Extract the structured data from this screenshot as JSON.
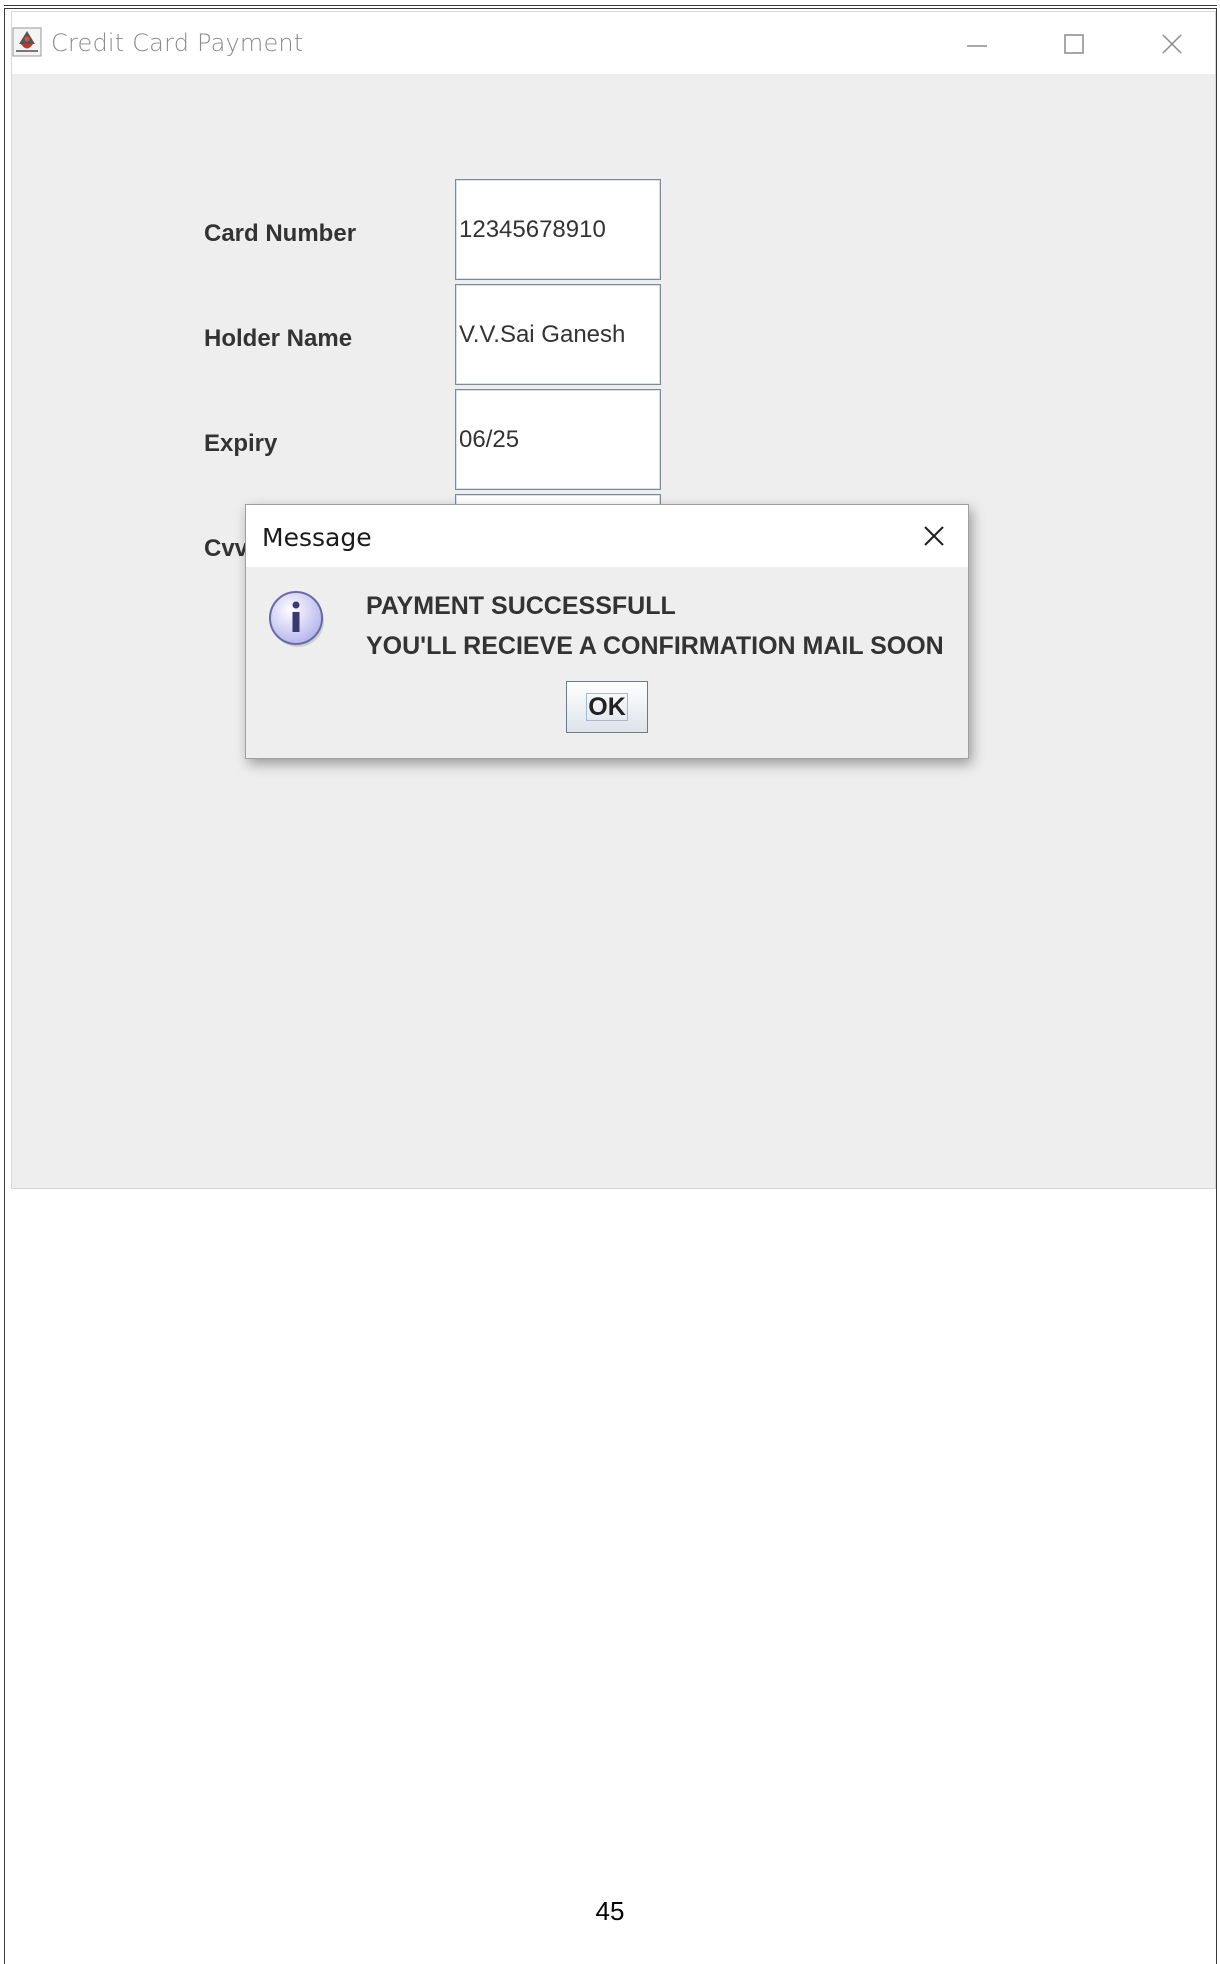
{
  "window": {
    "title": "Credit Card Payment",
    "app_icon": "java-duke-icon"
  },
  "form": {
    "fields": [
      {
        "label": "Card Number",
        "value": "12345678910"
      },
      {
        "label": "Holder Name",
        "value": "V.V.Sai Ganesh"
      },
      {
        "label": "Expiry",
        "value": "06/25"
      },
      {
        "label": "Cvv",
        "value": ""
      }
    ]
  },
  "dialog": {
    "title": "Message",
    "icon": "info-icon",
    "line1": "PAYMENT SUCCESSFULL",
    "line2": "YOU'LL RECIEVE A CONFIRMATION MAIL SOON",
    "ok_label": "OK"
  },
  "page": {
    "number": "45"
  },
  "colors": {
    "window_bg": "#eeeeee",
    "titlebar_bg": "#ffffff",
    "label_text": "#333333",
    "info_icon_fill": "#c9c8f2"
  }
}
